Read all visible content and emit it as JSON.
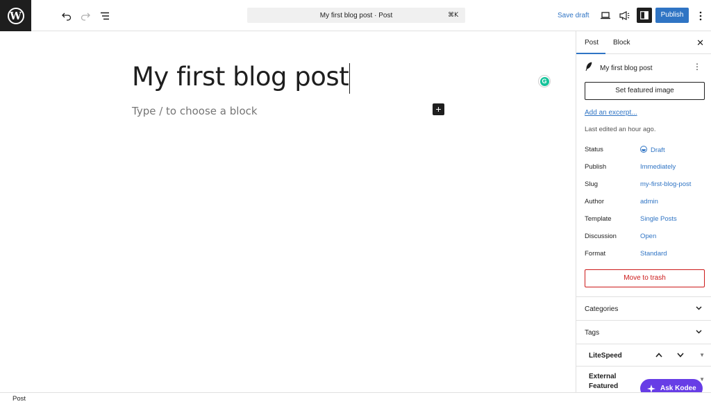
{
  "topbar": {
    "logo_letter": "W",
    "add_label": "+",
    "command_title": "My first blog post · Post",
    "command_shortcut": "⌘K",
    "save_draft": "Save draft",
    "publish": "Publish"
  },
  "editor": {
    "title": "My first blog post",
    "placeholder": "Type / to choose a block",
    "inline_add": "+",
    "grammarly_letter": "G"
  },
  "sidebar": {
    "tabs": [
      "Post",
      "Block"
    ],
    "close": "✕",
    "post_title": "My first blog post",
    "more": "⋮",
    "featured_image": "Set featured image",
    "excerpt": "Add an excerpt...",
    "last_edited": "Last edited an hour ago.",
    "rows": [
      {
        "label": "Status",
        "value": "Draft"
      },
      {
        "label": "Publish",
        "value": "Immediately"
      },
      {
        "label": "Slug",
        "value": "my-first-blog-post"
      },
      {
        "label": "Author",
        "value": "admin"
      },
      {
        "label": "Template",
        "value": "Single Posts"
      },
      {
        "label": "Discussion",
        "value": "Open"
      },
      {
        "label": "Format",
        "value": "Standard"
      }
    ],
    "trash": "Move to trash",
    "categories": "Categories",
    "tags": "Tags",
    "litespeed": "LiteSpeed",
    "external_featured": "External Featured Image"
  },
  "kodee": {
    "label": "Ask Kodee"
  },
  "footer": {
    "label": "Post"
  },
  "colors": {
    "accent": "#2f74c4",
    "danger": "#cc1818",
    "kodee": "#673de6",
    "dark": "#1e1e1e"
  },
  "icons": [
    "wordpress-icon",
    "undo-icon",
    "redo-icon",
    "list-view-icon",
    "preview-icon",
    "megaphone-icon",
    "settings-sidebar-icon",
    "options-icon",
    "feather-icon",
    "chevron-down-icon",
    "chevron-up-icon",
    "grammarly-icon",
    "kodee-icon"
  ]
}
